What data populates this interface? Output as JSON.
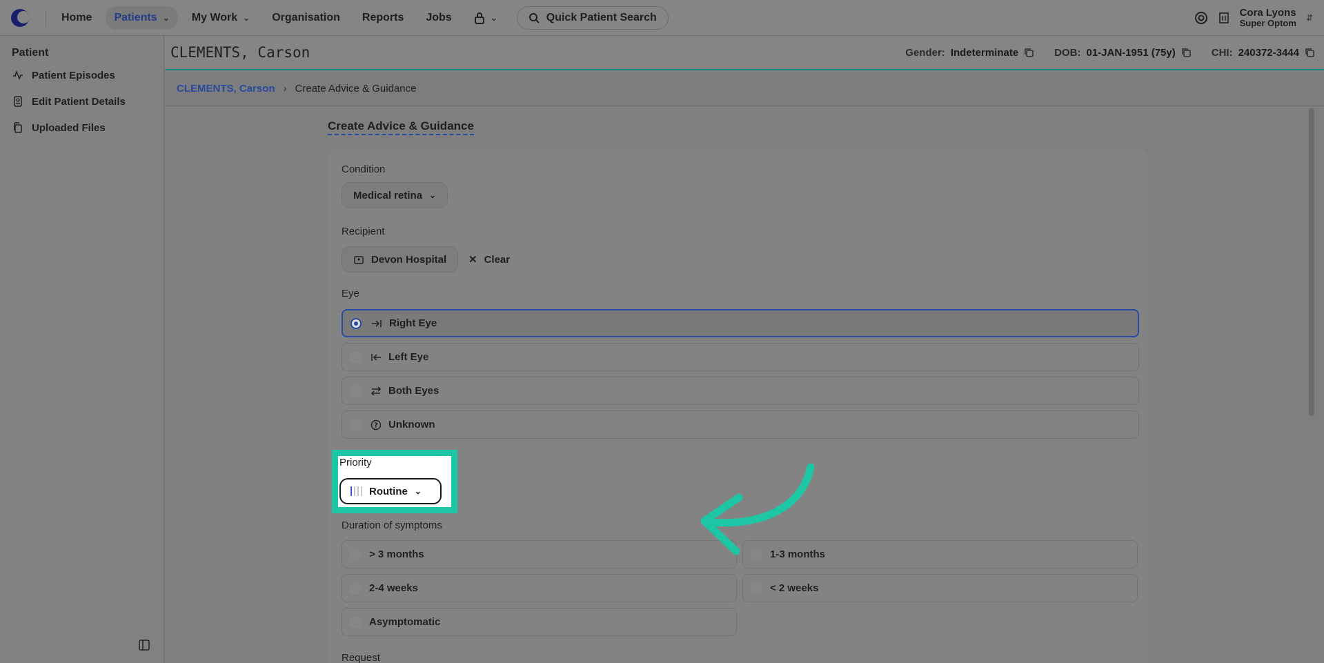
{
  "nav": {
    "home": "Home",
    "patients": "Patients",
    "my_work": "My Work",
    "organisation": "Organisation",
    "reports": "Reports",
    "jobs": "Jobs",
    "search": "Quick Patient Search",
    "user_name": "Cora Lyons",
    "user_role": "Super Optom"
  },
  "sidebar": {
    "title": "Patient",
    "items": [
      {
        "label": "Patient Episodes",
        "icon": "activity-icon"
      },
      {
        "label": "Edit Patient Details",
        "icon": "id-card-icon"
      },
      {
        "label": "Uploaded Files",
        "icon": "files-icon"
      }
    ]
  },
  "patient": {
    "name": "CLEMENTS, Carson",
    "gender_label": "Gender:",
    "gender": "Indeterminate",
    "dob_label": "DOB:",
    "dob": "01-JAN-1951 (75y)",
    "chi_label": "CHI:",
    "chi": "240372-3444"
  },
  "breadcrumb": {
    "link": "CLEMENTS, Carson",
    "current": "Create Advice & Guidance"
  },
  "form": {
    "title": "Create Advice & Guidance",
    "condition_label": "Condition",
    "condition_value": "Medical retina",
    "recipient_label": "Recipient",
    "recipient_value": "Devon Hospital",
    "clear_label": "Clear",
    "eye_label": "Eye",
    "eye_options": [
      "Right Eye",
      "Left Eye",
      "Both Eyes",
      "Unknown"
    ],
    "eye_selected": "Right Eye",
    "priority_label": "Priority",
    "priority_value": "Routine",
    "priority_level": 1,
    "duration_label": "Duration of symptoms",
    "duration_options": [
      "> 3 months",
      "1-3 months",
      "2-4 weeks",
      "< 2 weeks",
      "Asymptomatic"
    ],
    "request_label": "Request"
  },
  "colors": {
    "accent": "#2a4aa0",
    "highlight": "#1dc7a5",
    "patient_bar_border": "#1a8a7a"
  }
}
